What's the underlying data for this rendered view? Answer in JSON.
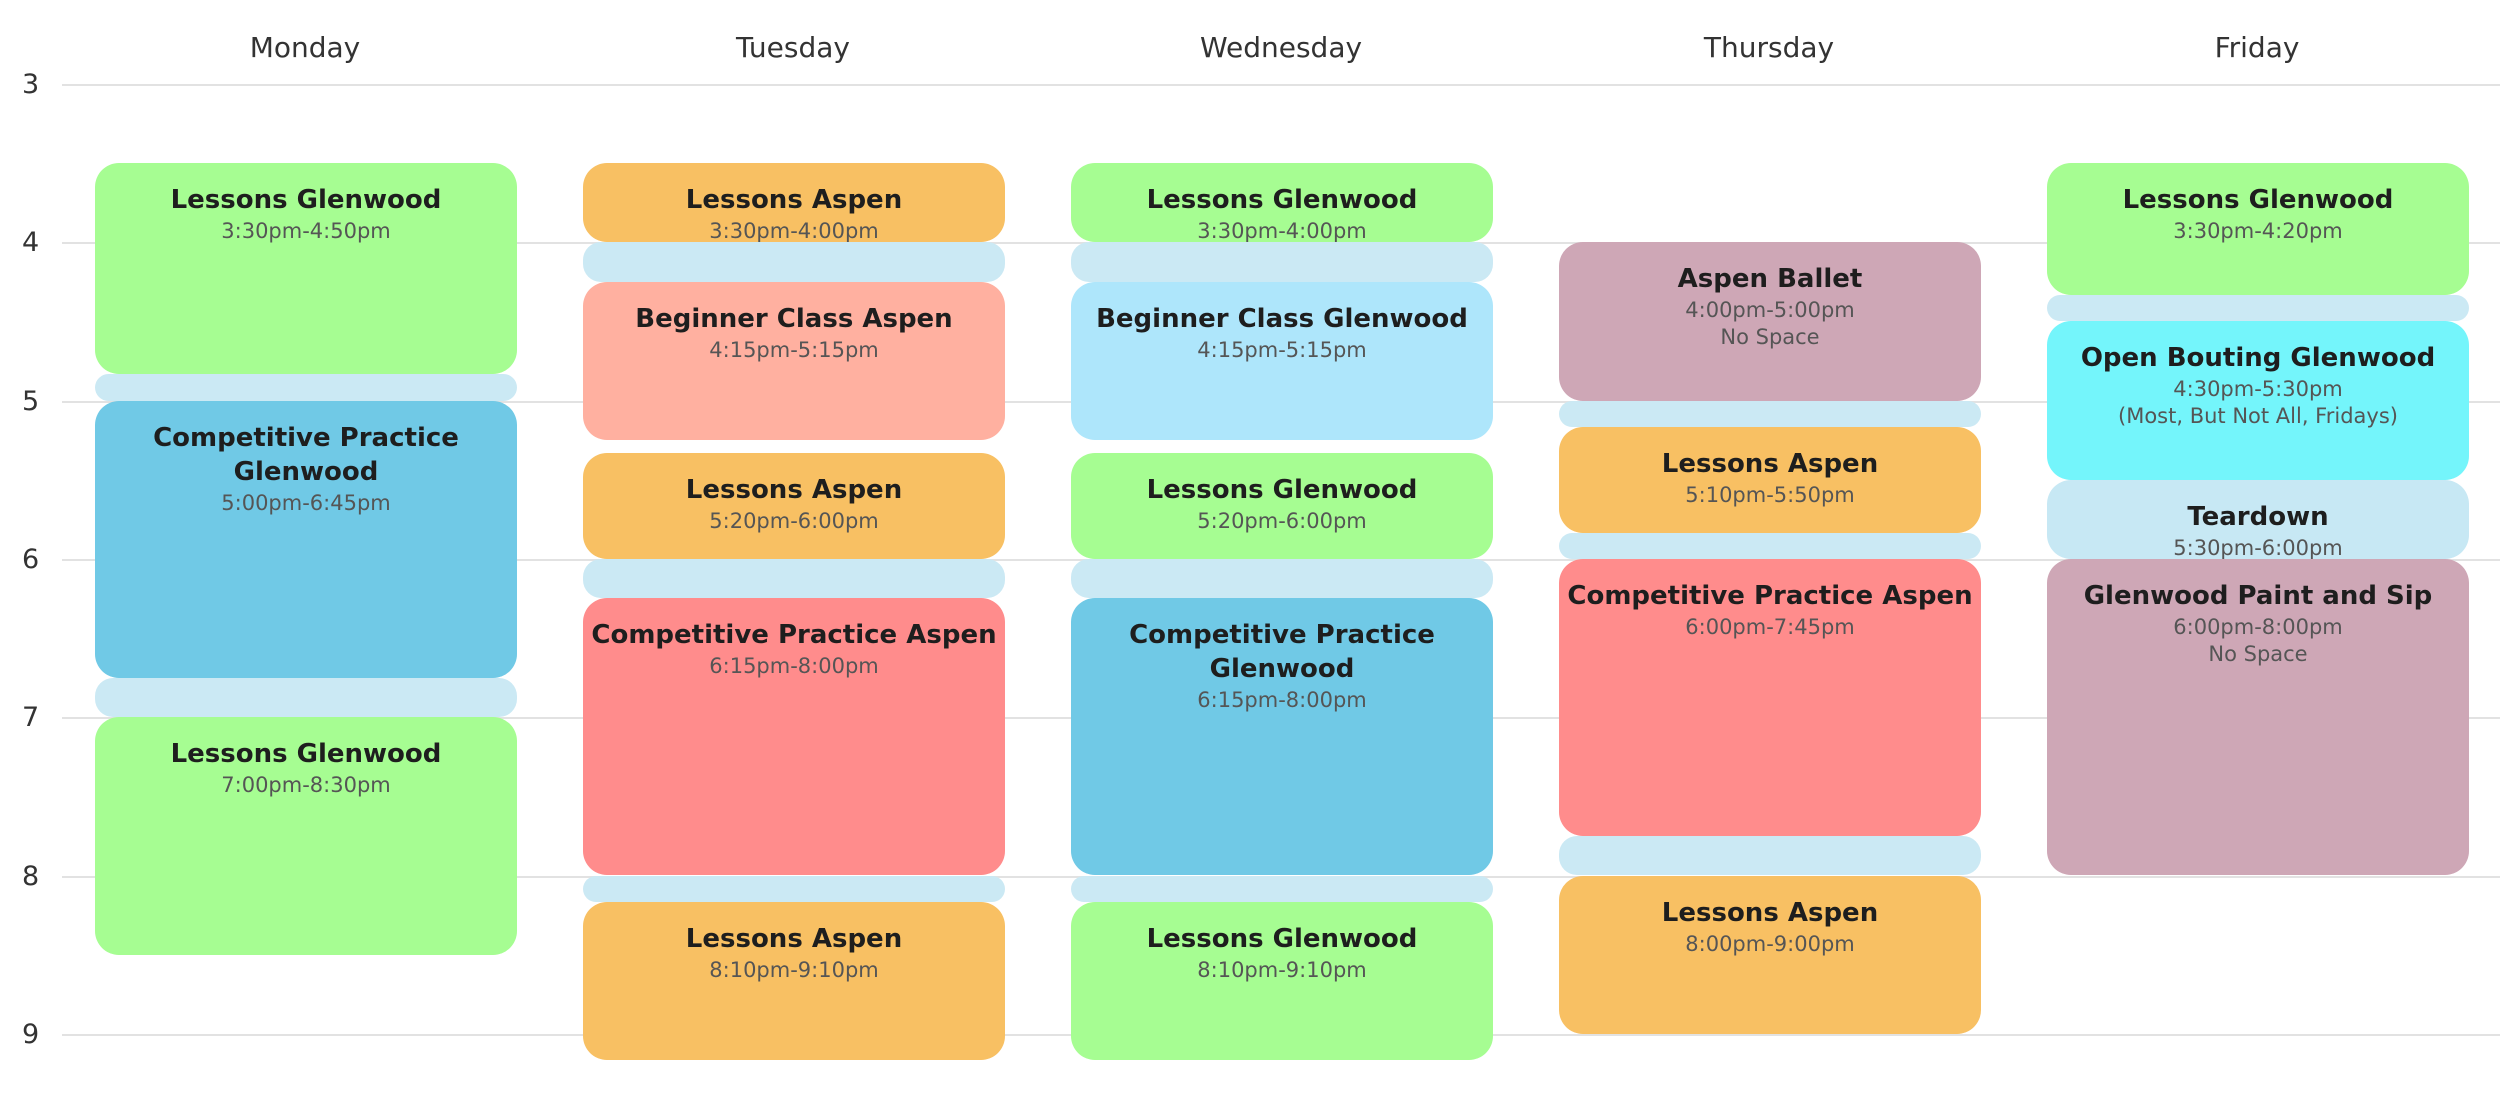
{
  "days": [
    "Monday",
    "Tuesday",
    "Wednesday",
    "Thursday",
    "Friday"
  ],
  "hours": [
    "3",
    "4",
    "5",
    "6",
    "7",
    "8",
    "9"
  ],
  "colors": {
    "glenwood_lessons": "#a6fd92",
    "aspen_lessons": "#f8c063",
    "beginner_aspen": "#ffb0a0",
    "beginner_glenwood": "#aee6fb",
    "competitive_glenwood": "#70c9e6",
    "competitive_aspen": "#ff8c8c",
    "special": "#cea7b6",
    "open_bouting": "#74f5fb",
    "teardown": "#c7e8f4",
    "gap": "#cbe9f4"
  },
  "events": [
    {
      "day": 0,
      "start": 3.5,
      "end": 4.8333,
      "title": "Lessons Glenwood",
      "time": "3:30pm-4:50pm",
      "note": "",
      "color": "glenwood_lessons"
    },
    {
      "day": 0,
      "start": 5.0,
      "end": 6.75,
      "title": "Competitive Practice Glenwood",
      "time": "5:00pm-6:45pm",
      "note": "",
      "color": "competitive_glenwood"
    },
    {
      "day": 0,
      "start": 7.0,
      "end": 8.5,
      "title": "Lessons Glenwood",
      "time": "7:00pm-8:30pm",
      "note": "",
      "color": "glenwood_lessons"
    },
    {
      "day": 1,
      "start": 3.5,
      "end": 4.0,
      "title": "Lessons Aspen",
      "time": "3:30pm-4:00pm",
      "note": "",
      "color": "aspen_lessons"
    },
    {
      "day": 1,
      "start": 4.25,
      "end": 5.25,
      "title": "Beginner Class Aspen",
      "time": "4:15pm-5:15pm",
      "note": "",
      "color": "beginner_aspen"
    },
    {
      "day": 1,
      "start": 5.3333,
      "end": 6.0,
      "title": "Lessons Aspen",
      "time": "5:20pm-6:00pm",
      "note": "",
      "color": "aspen_lessons"
    },
    {
      "day": 1,
      "start": 6.25,
      "end": 8.0,
      "title": "Competitive Practice Aspen",
      "time": "6:15pm-8:00pm",
      "note": "",
      "color": "competitive_aspen"
    },
    {
      "day": 1,
      "start": 8.1667,
      "end": 9.1667,
      "title": "Lessons Aspen",
      "time": "8:10pm-9:10pm",
      "note": "",
      "color": "aspen_lessons"
    },
    {
      "day": 2,
      "start": 3.5,
      "end": 4.0,
      "title": "Lessons Glenwood",
      "time": "3:30pm-4:00pm",
      "note": "",
      "color": "glenwood_lessons"
    },
    {
      "day": 2,
      "start": 4.25,
      "end": 5.25,
      "title": "Beginner Class Glenwood",
      "time": "4:15pm-5:15pm",
      "note": "",
      "color": "beginner_glenwood"
    },
    {
      "day": 2,
      "start": 5.3333,
      "end": 6.0,
      "title": "Lessons Glenwood",
      "time": "5:20pm-6:00pm",
      "note": "",
      "color": "glenwood_lessons"
    },
    {
      "day": 2,
      "start": 6.25,
      "end": 8.0,
      "title": "Competitive Practice Glenwood",
      "time": "6:15pm-8:00pm",
      "note": "",
      "color": "competitive_glenwood"
    },
    {
      "day": 2,
      "start": 8.1667,
      "end": 9.1667,
      "title": "Lessons Glenwood",
      "time": "8:10pm-9:10pm",
      "note": "",
      "color": "glenwood_lessons"
    },
    {
      "day": 3,
      "start": 4.0,
      "end": 5.0,
      "title": "Aspen Ballet",
      "time": "4:00pm-5:00pm",
      "note": "No Space",
      "color": "special"
    },
    {
      "day": 3,
      "start": 5.1667,
      "end": 5.8333,
      "title": "Lessons Aspen",
      "time": "5:10pm-5:50pm",
      "note": "",
      "color": "aspen_lessons"
    },
    {
      "day": 3,
      "start": 6.0,
      "end": 7.75,
      "title": "Competitive Practice Aspen",
      "time": "6:00pm-7:45pm",
      "note": "",
      "color": "competitive_aspen"
    },
    {
      "day": 3,
      "start": 8.0,
      "end": 9.0,
      "title": "Lessons Aspen",
      "time": "8:00pm-9:00pm",
      "note": "",
      "color": "aspen_lessons"
    },
    {
      "day": 4,
      "start": 3.5,
      "end": 4.3333,
      "title": "Lessons Glenwood",
      "time": "3:30pm-4:20pm",
      "note": "",
      "color": "glenwood_lessons"
    },
    {
      "day": 4,
      "start": 4.5,
      "end": 5.5,
      "title": "Open Bouting Glenwood",
      "time": "4:30pm-5:30pm",
      "note": "(Most, But Not All, Fridays)",
      "color": "open_bouting"
    },
    {
      "day": 4,
      "start": 5.5,
      "end": 6.0,
      "title": "Teardown",
      "time": "5:30pm-6:00pm",
      "note": "",
      "color": "teardown"
    },
    {
      "day": 4,
      "start": 6.0,
      "end": 8.0,
      "title": "Glenwood Paint and Sip",
      "time": "6:00pm-8:00pm",
      "note": "No Space",
      "color": "special"
    }
  ],
  "gaps": [
    {
      "day": 0,
      "start": 4.8333,
      "end": 5.0
    },
    {
      "day": 0,
      "start": 6.75,
      "end": 7.0
    },
    {
      "day": 1,
      "start": 4.0,
      "end": 4.25
    },
    {
      "day": 1,
      "start": 6.0,
      "end": 6.25
    },
    {
      "day": 1,
      "start": 8.0,
      "end": 8.1667
    },
    {
      "day": 2,
      "start": 4.0,
      "end": 4.25
    },
    {
      "day": 2,
      "start": 6.0,
      "end": 6.25
    },
    {
      "day": 2,
      "start": 8.0,
      "end": 8.1667
    },
    {
      "day": 3,
      "start": 5.0,
      "end": 5.1667
    },
    {
      "day": 3,
      "start": 5.8333,
      "end": 6.0
    },
    {
      "day": 3,
      "start": 7.75,
      "end": 8.0
    },
    {
      "day": 4,
      "start": 4.3333,
      "end": 4.5
    }
  ]
}
